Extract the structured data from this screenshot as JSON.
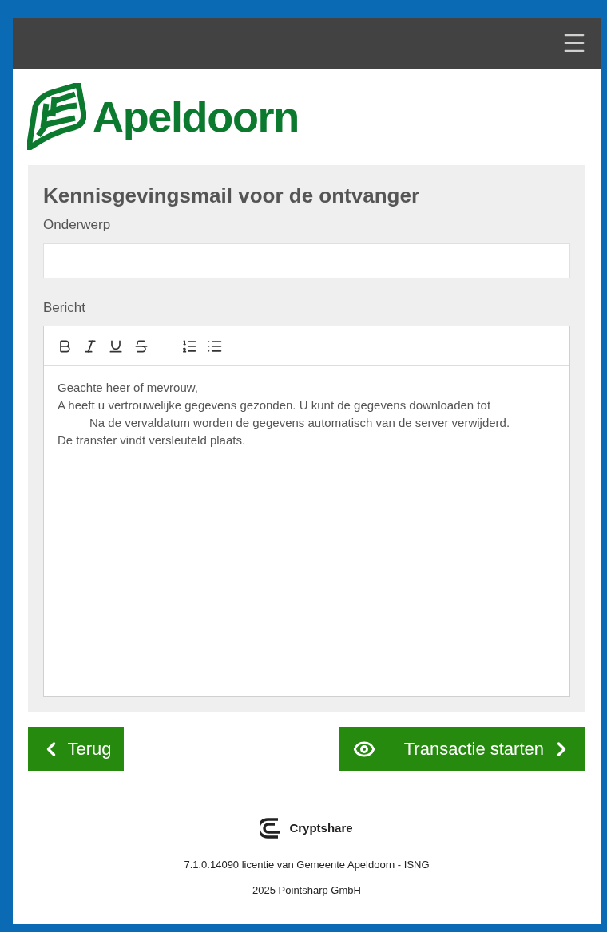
{
  "logo": {
    "text": "Apeldoorn"
  },
  "form": {
    "title": "Kennisgevingsmail voor de ontvanger",
    "subject": {
      "label": "Onderwerp"
    },
    "message": {
      "label": "Bericht",
      "toolbar": [
        {
          "kind": "bold"
        },
        {
          "kind": "italic"
        },
        {
          "kind": "underline"
        },
        {
          "kind": "strike"
        },
        {
          "kind": "ordered"
        },
        {
          "kind": "bullets"
        }
      ],
      "lines": [
        {
          "text": "Geachte heer of mevrouw,",
          "indented": false
        },
        {
          "text": "A heeft u vertrouwelijke gegevens gezonden. U kunt de gegevens downloaden tot",
          "indented": false
        },
        {
          "text": "Na de vervaldatum worden de gegevens automatisch van de server verwijderd.",
          "indented": true
        },
        {
          "text": "De transfer vindt versleuteld plaats.",
          "indented": false
        }
      ]
    }
  },
  "buttons": {
    "back": "Terug",
    "start": "Transactie starten"
  },
  "footer": {
    "brand": "Cryptshare",
    "license": "7.1.0.14090 licentie van Gemeente Apeldoorn - ISNG",
    "copyright": "2025 Pointsharp GmbH"
  }
}
